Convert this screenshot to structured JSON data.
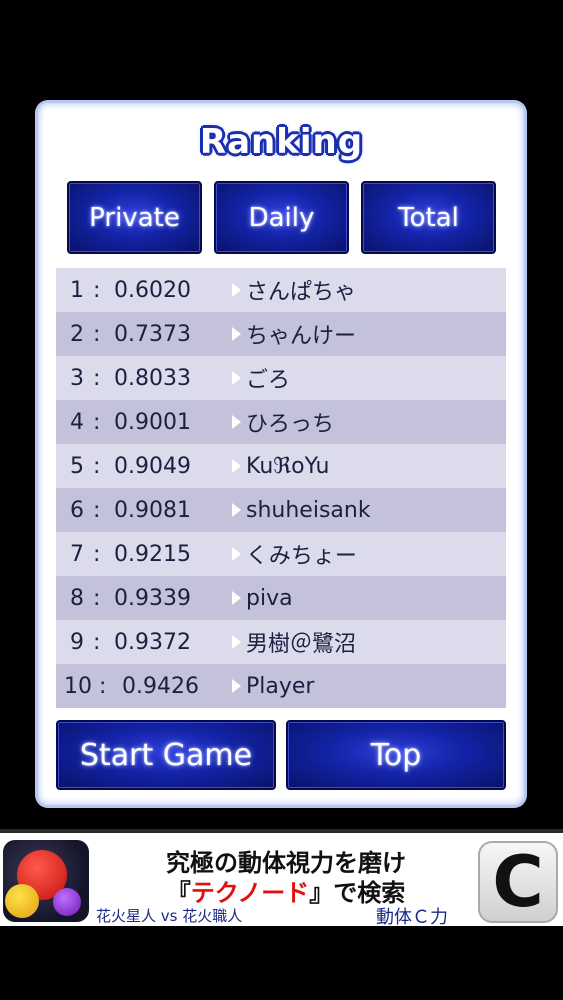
{
  "title": "Ranking",
  "tabs": [
    {
      "label": "Private"
    },
    {
      "label": "Daily"
    },
    {
      "label": "Total"
    }
  ],
  "rankings": [
    {
      "rank": "1",
      "score": "0.6020",
      "name": "さんぱちゃ"
    },
    {
      "rank": "2",
      "score": "0.7373",
      "name": "ちゃんけー"
    },
    {
      "rank": "3",
      "score": "0.8033",
      "name": "ごろ"
    },
    {
      "rank": "4",
      "score": "0.9001",
      "name": "ひろっち"
    },
    {
      "rank": "5",
      "score": "0.9049",
      "name": "KuℜoYu"
    },
    {
      "rank": "6",
      "score": "0.9081",
      "name": "shuheisank"
    },
    {
      "rank": "7",
      "score": "0.9215",
      "name": "くみちょー"
    },
    {
      "rank": "8",
      "score": "0.9339",
      "name": "piva"
    },
    {
      "rank": "9",
      "score": "0.9372",
      "name": "男樹＠鷺沼"
    },
    {
      "rank": "10",
      "score": "0.9426",
      "name": "Player"
    }
  ],
  "buttons": {
    "start_game": "Start Game",
    "top": "Top"
  },
  "ad": {
    "line1": "究極の動体視力を磨け",
    "line2_prefix": "『",
    "line2_highlight": "テクノード",
    "line2_suffix": "』で検索",
    "sub_left": "花火星人 vs 花火職人",
    "sub_right": "動体Ｃ力",
    "logo_letter": "C"
  },
  "colors": {
    "button_blue": "#1323a6",
    "row_light": "#dcdbec",
    "row_dark": "#c3c2da",
    "ad_highlight": "#e01010"
  }
}
